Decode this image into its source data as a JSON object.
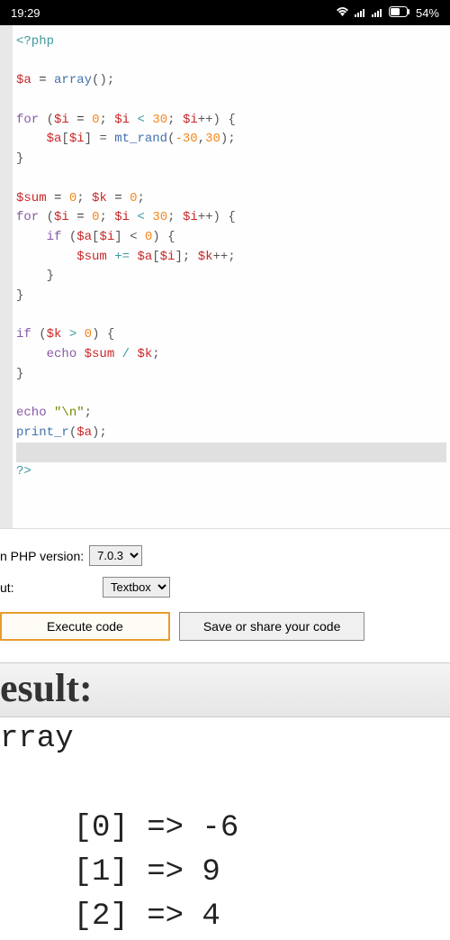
{
  "status": {
    "time": "19:29",
    "battery": "54%"
  },
  "code": {
    "l1": "<?php",
    "l3_var": "$a",
    "l3_eq": " = ",
    "l3_fn": "array",
    "l3_end": "();",
    "l5_kw": "for",
    "l5_c1": " (",
    "l5_v1": "$i",
    "l5_eq1": " = ",
    "l5_n1": "0",
    "l5_sc1": "; ",
    "l5_v2": "$i",
    "l5_lt": " < ",
    "l5_n2": "30",
    "l5_sc2": "; ",
    "l5_v3": "$i",
    "l5_inc": "++) {",
    "l6_ind": "    ",
    "l6_v1": "$a",
    "l6_br1": "[",
    "l6_v2": "$i",
    "l6_br2": "] = ",
    "l6_fn": "mt_rand",
    "l6_c1": "(",
    "l6_n1": "-30",
    "l6_cm": ",",
    "l6_n2": "30",
    "l6_end": ");",
    "l7": "}",
    "l9_v1": "$sum",
    "l9_eq1": " = ",
    "l9_n1": "0",
    "l9_sc1": "; ",
    "l9_v2": "$k",
    "l9_eq2": " = ",
    "l9_n2": "0",
    "l9_end": ";",
    "l10_kw": "for",
    "l10_c1": " (",
    "l10_v1": "$i",
    "l10_eq1": " = ",
    "l10_n1": "0",
    "l10_sc1": "; ",
    "l10_v2": "$i",
    "l10_lt": " < ",
    "l10_n2": "30",
    "l10_sc2": "; ",
    "l10_v3": "$i",
    "l10_inc": "++) {",
    "l11_ind": "    ",
    "l11_kw": "if",
    "l11_c1": " (",
    "l11_v1": "$a",
    "l11_br1": "[",
    "l11_v2": "$i",
    "l11_br2": "] < ",
    "l11_n1": "0",
    "l11_end": ") {",
    "l12_ind": "        ",
    "l12_v1": "$sum",
    "l12_op": " += ",
    "l12_v2": "$a",
    "l12_br1": "[",
    "l12_v3": "$i",
    "l12_br2": "]; ",
    "l12_v4": "$k",
    "l12_inc": "++;",
    "l13": "    }",
    "l14": "}",
    "l16_kw": "if",
    "l16_c1": " (",
    "l16_v1": "$k",
    "l16_gt": " > ",
    "l16_n1": "0",
    "l16_end": ") {",
    "l17_ind": "    ",
    "l17_kw": "echo",
    "l17_sp": " ",
    "l17_v1": "$sum",
    "l17_div": " / ",
    "l17_v2": "$k",
    "l17_end": ";",
    "l18": "}",
    "l20_kw": "echo",
    "l20_sp": " ",
    "l20_str": "\"\\n\"",
    "l20_end": ";",
    "l21_fn": "print_r",
    "l21_c1": "(",
    "l21_v1": "$a",
    "l21_end": ");",
    "l23": "?>"
  },
  "form": {
    "php_label": "n PHP version:",
    "php_value": "7.0.3",
    "out_label": "ut:",
    "out_value": "Textbox"
  },
  "buttons": {
    "execute": "Execute code",
    "save": "Save or share your code"
  },
  "result": {
    "heading": "esult:",
    "line1": "rray",
    "r0": "    [0] => -6",
    "r1": "    [1] => 9",
    "r2": "    [2] => 4"
  }
}
